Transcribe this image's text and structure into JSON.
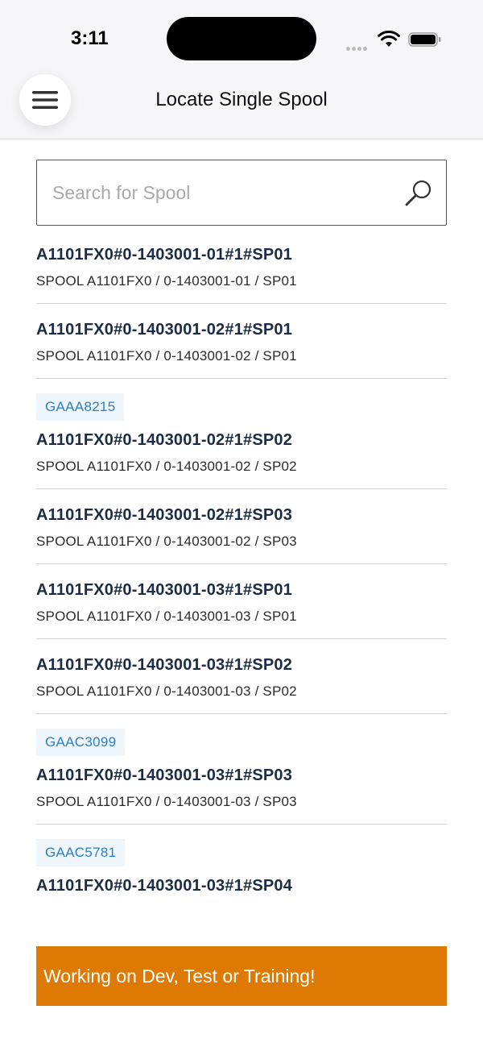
{
  "status_bar": {
    "time": "3:11"
  },
  "header": {
    "title": "Locate Single Spool",
    "menu_icon": "hamburger-menu-icon"
  },
  "search": {
    "placeholder": "Search for Spool",
    "value": "",
    "icon": "search-icon"
  },
  "spools": [
    {
      "badge": "",
      "title": "A1101FX0#0-1403001-01#1#SP01",
      "subtitle": "SPOOL A1101FX0 / 0-1403001-01 / SP01"
    },
    {
      "badge": "",
      "title": "A1101FX0#0-1403001-02#1#SP01",
      "subtitle": "SPOOL A1101FX0 / 0-1403001-02 / SP01"
    },
    {
      "badge": "GAAA8215",
      "title": "A1101FX0#0-1403001-02#1#SP02",
      "subtitle": "SPOOL A1101FX0 / 0-1403001-02 / SP02"
    },
    {
      "badge": "",
      "title": "A1101FX0#0-1403001-02#1#SP03",
      "subtitle": "SPOOL A1101FX0 / 0-1403001-02 / SP03"
    },
    {
      "badge": "",
      "title": "A1101FX0#0-1403001-03#1#SP01",
      "subtitle": "SPOOL A1101FX0 / 0-1403001-03 / SP01"
    },
    {
      "badge": "",
      "title": "A1101FX0#0-1403001-03#1#SP02",
      "subtitle": "SPOOL A1101FX0 / 0-1403001-03 / SP02"
    },
    {
      "badge": "GAAC3099",
      "title": "A1101FX0#0-1403001-03#1#SP03",
      "subtitle": "SPOOL A1101FX0 / 0-1403001-03 / SP03"
    },
    {
      "badge": "GAAC5781",
      "title": "A1101FX0#0-1403001-03#1#SP04",
      "subtitle": ""
    }
  ],
  "banner": {
    "text": "Working on Dev, Test or Training!"
  },
  "colors": {
    "title_text": "#1c2c45",
    "badge_text": "#2a7fc2",
    "badge_bg": "#eef5fb",
    "banner_bg": "#de7a03"
  }
}
